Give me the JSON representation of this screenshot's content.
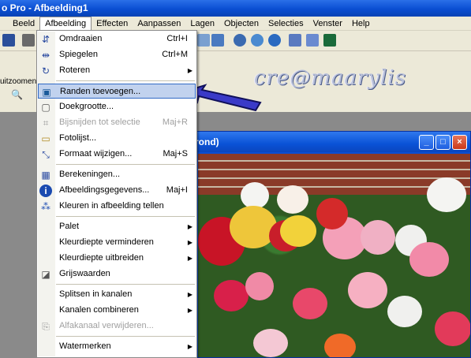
{
  "window": {
    "title": "o Pro - Afbeelding1"
  },
  "menubar": {
    "items": [
      "Beeld",
      "Afbeelding",
      "Effecten",
      "Aanpassen",
      "Lagen",
      "Objecten",
      "Selecties",
      "Venster",
      "Help"
    ]
  },
  "leftpanel": {
    "zoom_label": "uitzoomen:"
  },
  "watermark": {
    "text": "cre@maarylis"
  },
  "docwindow": {
    "title_suffix": "rond)"
  },
  "menu": {
    "items": [
      {
        "label": "Omdraaien",
        "shortcut": "Ctrl+I",
        "icon": "flip-icon"
      },
      {
        "label": "Spiegelen",
        "shortcut": "Ctrl+M",
        "icon": "mirror-icon"
      },
      {
        "label": "Roteren",
        "shortcut": "",
        "icon": "rotate-icon",
        "submenu": true
      },
      {
        "label": "Randen toevoegen...",
        "shortcut": "",
        "icon": "add-borders-icon",
        "highlighted": true
      },
      {
        "label": "Doekgrootte...",
        "shortcut": "",
        "icon": "canvas-size-icon"
      },
      {
        "label": "Bijsnijden tot selectie",
        "shortcut": "Maj+R",
        "icon": "crop-icon",
        "disabled": true
      },
      {
        "label": "Fotolijst...",
        "shortcut": "",
        "icon": "picture-frame-icon"
      },
      {
        "label": "Formaat wijzigen...",
        "shortcut": "Maj+S",
        "icon": "resize-icon"
      },
      {
        "label": "Berekeningen...",
        "shortcut": "",
        "icon": "calculations-icon"
      },
      {
        "label": "Afbeeldingsgegevens...",
        "shortcut": "Maj+I",
        "icon": "info-icon"
      },
      {
        "label": "Kleuren in afbeelding tellen",
        "shortcut": "",
        "icon": "count-colors-icon"
      },
      {
        "label": "Palet",
        "shortcut": "",
        "icon": "",
        "submenu": true
      },
      {
        "label": "Kleurdiepte verminderen",
        "shortcut": "",
        "icon": "",
        "submenu": true
      },
      {
        "label": "Kleurdiepte uitbreiden",
        "shortcut": "",
        "icon": "",
        "submenu": true
      },
      {
        "label": "Grijswaarden",
        "shortcut": "",
        "icon": "greyscale-icon"
      },
      {
        "label": "Splitsen in kanalen",
        "shortcut": "",
        "icon": "",
        "submenu": true
      },
      {
        "label": "Kanalen combineren",
        "shortcut": "",
        "icon": "",
        "submenu": true
      },
      {
        "label": "Alfakanaal verwijderen...",
        "shortcut": "",
        "icon": "remove-alpha-icon",
        "disabled": true
      },
      {
        "label": "Watermerken",
        "shortcut": "",
        "icon": "",
        "submenu": true
      }
    ]
  },
  "colors": {
    "titlebar": "#0a4ed2",
    "highlight": "#c1d2ee",
    "menu_bg": "#ece9d8"
  }
}
